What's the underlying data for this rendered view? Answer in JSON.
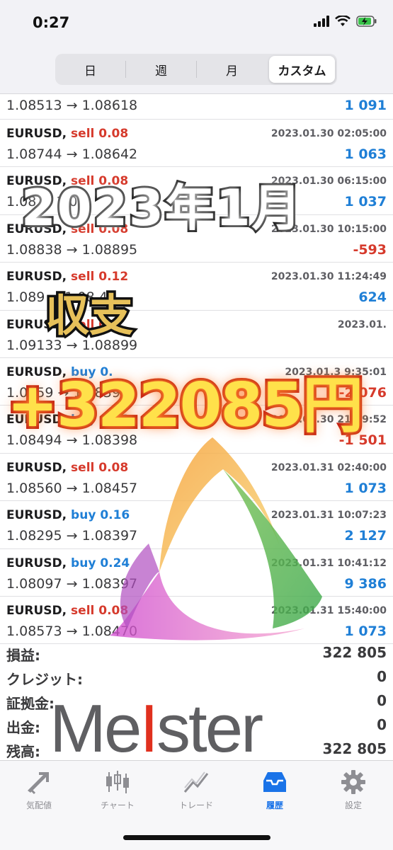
{
  "status": {
    "time": "0:27"
  },
  "segments": [
    "日",
    "週",
    "月",
    "カスタム"
  ],
  "segments_active_index": 3,
  "first_row": {
    "prices": "1.08513 → 1.08618",
    "profit": "1 091"
  },
  "trades": [
    {
      "symbol": "EURUSD,",
      "side": "sell",
      "volume": "sell 0.08",
      "date": "2023.01.30 02:05:00",
      "prices": "1.08744 → 1.08642",
      "profit": "1 063",
      "sign": "pos"
    },
    {
      "symbol": "EURUSD,",
      "side": "sell",
      "volume": "sell 0.08",
      "date": "2023.01.30 06:15:00",
      "prices": "1.08 → 1.08",
      "profit": "1 037",
      "sign": "pos"
    },
    {
      "symbol": "EURUSD,",
      "side": "sell",
      "volume": "sell 0.08",
      "date": "2023.01.30 10:15:00",
      "prices": "1.08838 → 1.08895",
      "profit": "-593",
      "sign": "neg"
    },
    {
      "symbol": "EURUSD,",
      "side": "sell",
      "volume": "sell 0.12",
      "date": "2023.01.30 11:24:49",
      "prices": "1.089 → 1.08 4",
      "profit": "624",
      "sign": "pos"
    },
    {
      "symbol": "EURUSD,",
      "side": "sell",
      "volume": "sell 0.",
      "date": "2023.01.",
      "prices": "1.09133 → 1.08899",
      "profit": "",
      "sign": "pos"
    },
    {
      "symbol": "EURUSD,",
      "side": "buy",
      "volume": "buy 0.",
      "date": "2023.01.3 9:35:01",
      "prices": "1.0859 → 1.08399",
      "profit": "-2 076",
      "sign": "neg"
    },
    {
      "symbol": "EURUSD,",
      "side": "buy",
      "volume": "buy 0.12",
      "date": "2023.01.30 21:09:52",
      "prices": "1.08494 → 1.08398",
      "profit": "-1 501",
      "sign": "neg"
    },
    {
      "symbol": "EURUSD,",
      "side": "sell",
      "volume": "sell 0.08",
      "date": "2023.01.31 02:40:00",
      "prices": "1.08560 → 1.08457",
      "profit": "1 073",
      "sign": "pos"
    },
    {
      "symbol": "EURUSD,",
      "side": "buy",
      "volume": "buy 0.16",
      "date": "2023.01.31 10:07:23",
      "prices": "1.08295 → 1.08397",
      "profit": "2 127",
      "sign": "pos"
    },
    {
      "symbol": "EURUSD,",
      "side": "buy",
      "volume": "buy 0.24",
      "date": "2023.01.31 10:41:12",
      "prices": "1.08097 → 1.08397",
      "profit": "9 386",
      "sign": "pos"
    },
    {
      "symbol": "EURUSD,",
      "side": "sell",
      "volume": "sell 0.08",
      "date": "2023.01.31 15:40:00",
      "prices": "1.08573 → 1.08470",
      "profit": "1 073",
      "sign": "pos"
    }
  ],
  "summary": [
    {
      "label": "損益:",
      "value": "322 805"
    },
    {
      "label": "クレジット:",
      "value": "0"
    },
    {
      "label": "証拠金:",
      "value": "0"
    },
    {
      "label": "出金:",
      "value": "0"
    },
    {
      "label": "残高:",
      "value": "322 805"
    }
  ],
  "tabs": [
    {
      "label": "気配値",
      "icon": "quotes-arrows-icon"
    },
    {
      "label": "チャート",
      "icon": "candlestick-chart-icon"
    },
    {
      "label": "トレード",
      "icon": "trade-line-icon"
    },
    {
      "label": "履歴",
      "icon": "history-tray-icon"
    },
    {
      "label": "設定",
      "icon": "gear-icon"
    }
  ],
  "tabs_active_index": 3,
  "overlay": {
    "month": "2023年1月",
    "shushi": "収支",
    "amount": "+322085円",
    "brand_pre": "Me",
    "brand_i": "I",
    "brand_post": "ster"
  },
  "colors": {
    "sell": "#d63a2c",
    "buy": "#1f7fd6",
    "active_tab": "#1a73e8"
  }
}
